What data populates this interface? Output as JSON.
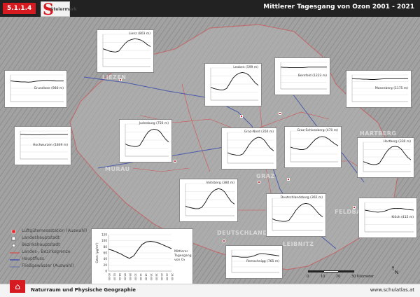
{
  "header": {
    "badge": "5.1.1.4",
    "logo_text": "Steiermark",
    "title": "Mittlerer Tagesgang von Ozon 2001 - 2021"
  },
  "colors": {
    "relief": "#a2a2a2",
    "styria": "#b5b5b5",
    "border": "#d7494a",
    "river": "#4a5aa8",
    "station": "#e8242b",
    "header_bg": "#222222",
    "badge": "#d71920"
  },
  "panels": [
    {
      "label": "Lienz (803 m)",
      "size": "large",
      "profile": "valley",
      "vals": [
        55,
        52,
        48,
        46,
        45,
        48,
        60,
        72,
        80,
        84,
        86,
        85,
        82,
        76,
        68,
        62
      ]
    },
    {
      "label": "Grundlsee (980 m)",
      "size": "small",
      "profile": "flat-high",
      "vals": [
        78,
        76,
        75,
        74,
        74,
        73,
        74,
        76,
        78,
        80,
        80,
        80,
        79,
        78,
        78,
        78
      ]
    },
    {
      "label": "Leoben (599 m)",
      "size": "large",
      "profile": "valley",
      "vals": [
        40,
        36,
        34,
        32,
        32,
        36,
        52,
        68,
        78,
        84,
        86,
        84,
        78,
        66,
        54,
        46
      ]
    },
    {
      "label": "Bernfeld (1223 m)",
      "size": "small",
      "profile": "flat-high",
      "vals": [
        82,
        81,
        81,
        80,
        80,
        80,
        80,
        80,
        81,
        82,
        82,
        82,
        82,
        82,
        82,
        82
      ]
    },
    {
      "label": "Masenberg (1175 m)",
      "size": "small",
      "profile": "flat-high",
      "vals": [
        86,
        85,
        85,
        84,
        84,
        83,
        83,
        84,
        85,
        86,
        86,
        86,
        86,
        86,
        86,
        86
      ]
    },
    {
      "label": "Hochwurzen (1849 m)",
      "size": "small",
      "profile": "flat-high",
      "vals": [
        88,
        88,
        87,
        87,
        86,
        86,
        86,
        87,
        87,
        88,
        88,
        88,
        88,
        88,
        88,
        88
      ]
    },
    {
      "label": "Judenburg (750 m)",
      "size": "large",
      "profile": "valley",
      "vals": [
        38,
        34,
        32,
        30,
        30,
        34,
        48,
        64,
        76,
        82,
        84,
        82,
        76,
        64,
        52,
        44
      ]
    },
    {
      "label": "Graz-Nord (350 m)",
      "size": "large",
      "profile": "valley",
      "vals": [
        34,
        30,
        28,
        26,
        26,
        30,
        44,
        60,
        72,
        80,
        84,
        82,
        74,
        60,
        48,
        40
      ]
    },
    {
      "label": "Graz-Schlossberg (470 m)",
      "size": "large",
      "profile": "valley",
      "vals": [
        48,
        44,
        42,
        40,
        40,
        42,
        52,
        64,
        74,
        80,
        82,
        80,
        74,
        66,
        58,
        52
      ]
    },
    {
      "label": "Hartberg (330 m)",
      "size": "large",
      "profile": "valley",
      "vals": [
        34,
        30,
        26,
        24,
        24,
        28,
        44,
        62,
        76,
        84,
        86,
        84,
        76,
        62,
        48,
        40
      ]
    },
    {
      "label": "Voitsberg (380 m)",
      "size": "large",
      "profile": "valley",
      "vals": [
        30,
        26,
        24,
        22,
        22,
        26,
        40,
        58,
        72,
        80,
        84,
        82,
        74,
        58,
        44,
        36
      ]
    },
    {
      "label": "Deutschlandsberg (365 m)",
      "size": "large",
      "profile": "valley",
      "vals": [
        36,
        32,
        30,
        28,
        28,
        32,
        46,
        62,
        74,
        82,
        84,
        82,
        74,
        62,
        50,
        42
      ]
    },
    {
      "label": "Klöch (415 m)",
      "size": "small",
      "profile": "flat-high",
      "vals": [
        74,
        72,
        70,
        68,
        67,
        68,
        70,
        74,
        78,
        80,
        80,
        80,
        78,
        76,
        75,
        74
      ]
    },
    {
      "label": "Remschnigg (765 m)",
      "size": "small",
      "profile": "flat-high",
      "vals": [
        72,
        72,
        70,
        68,
        68,
        68,
        70,
        74,
        80,
        84,
        84,
        82,
        80,
        78,
        76,
        74
      ]
    }
  ],
  "legend_chart": {
    "ylabel": "Ozon (µg/m³)",
    "yticks": [
      "120",
      "100",
      "80",
      "60",
      "40",
      "20",
      "0"
    ],
    "xticks": [
      "00:00",
      "02:00",
      "04:00",
      "06:00",
      "08:00",
      "10:00",
      "12:00",
      "14:00",
      "16:00",
      "18:00",
      "20:00",
      "22:00",
      "24:00"
    ],
    "caption": "Mittlerer Tagesgang von O₃",
    "vals": [
      72,
      68,
      62,
      56,
      48,
      42,
      50,
      70,
      88,
      96,
      98,
      96,
      92,
      86,
      80,
      74
    ]
  },
  "legend": {
    "items": [
      {
        "label": "Luftgütemessstation (Auswahl)",
        "symbol": "station"
      },
      {
        "label": "Landeshauptstadt",
        "symbol": "capital"
      },
      {
        "label": "Bezirkshauptstadt",
        "symbol": "district"
      },
      {
        "label": "Landes-, Bezirksgrenze",
        "symbol": "border"
      },
      {
        "label": "Hauptfluss",
        "symbol": "river"
      },
      {
        "label": "Fließgewässer (Auswahl)",
        "symbol": "stream"
      }
    ]
  },
  "regions": [
    {
      "label": "LIEZEN"
    },
    {
      "label": "GRAZ"
    },
    {
      "label": "HARTBERG"
    },
    {
      "label": "MURAU"
    },
    {
      "label": "LEIBNITZ"
    },
    {
      "label": "DEUTSCHLANDSBERG"
    },
    {
      "label": "FELDBACH"
    }
  ],
  "scale": {
    "ticks": [
      "0",
      "10",
      "20",
      "30 Kilometer"
    ]
  },
  "north_label": "N",
  "footer": {
    "left": "Naturraum und Physische Geographie",
    "right": "www.schulatlas.at"
  }
}
